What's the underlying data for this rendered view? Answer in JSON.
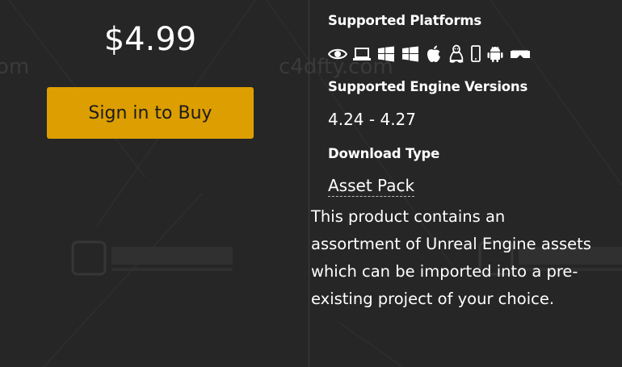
{
  "price": "$4.99",
  "buy_button": {
    "label": "Sign in to Buy",
    "color": "#dc9e00"
  },
  "platforms": {
    "title": "Supported Platforms",
    "icons": [
      "eye-icon",
      "laptop-icon",
      "windows-icon",
      "windows-icon",
      "apple-icon",
      "linux-icon",
      "phone-icon",
      "android-icon",
      "vr-headset-icon"
    ]
  },
  "engine": {
    "title": "Supported Engine Versions",
    "versions": "4.24 - 4.27"
  },
  "download": {
    "title": "Download Type",
    "type": "Asset Pack"
  },
  "description": "This product contains an assortment of Unreal Engine assets which can be imported into a pre-existing project of your choice.",
  "colors": {
    "background": "#262626",
    "divider": "#3e3e3e",
    "accent": "#dc9e00"
  }
}
